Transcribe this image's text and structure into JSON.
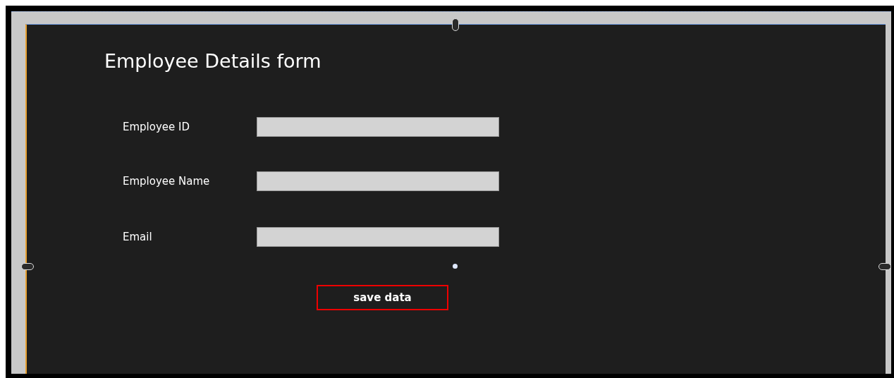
{
  "form": {
    "title": "Employee Details form",
    "fields": [
      {
        "label": "Employee ID"
      },
      {
        "label": "Employee Name"
      },
      {
        "label": "Email"
      }
    ],
    "button": "save data"
  }
}
